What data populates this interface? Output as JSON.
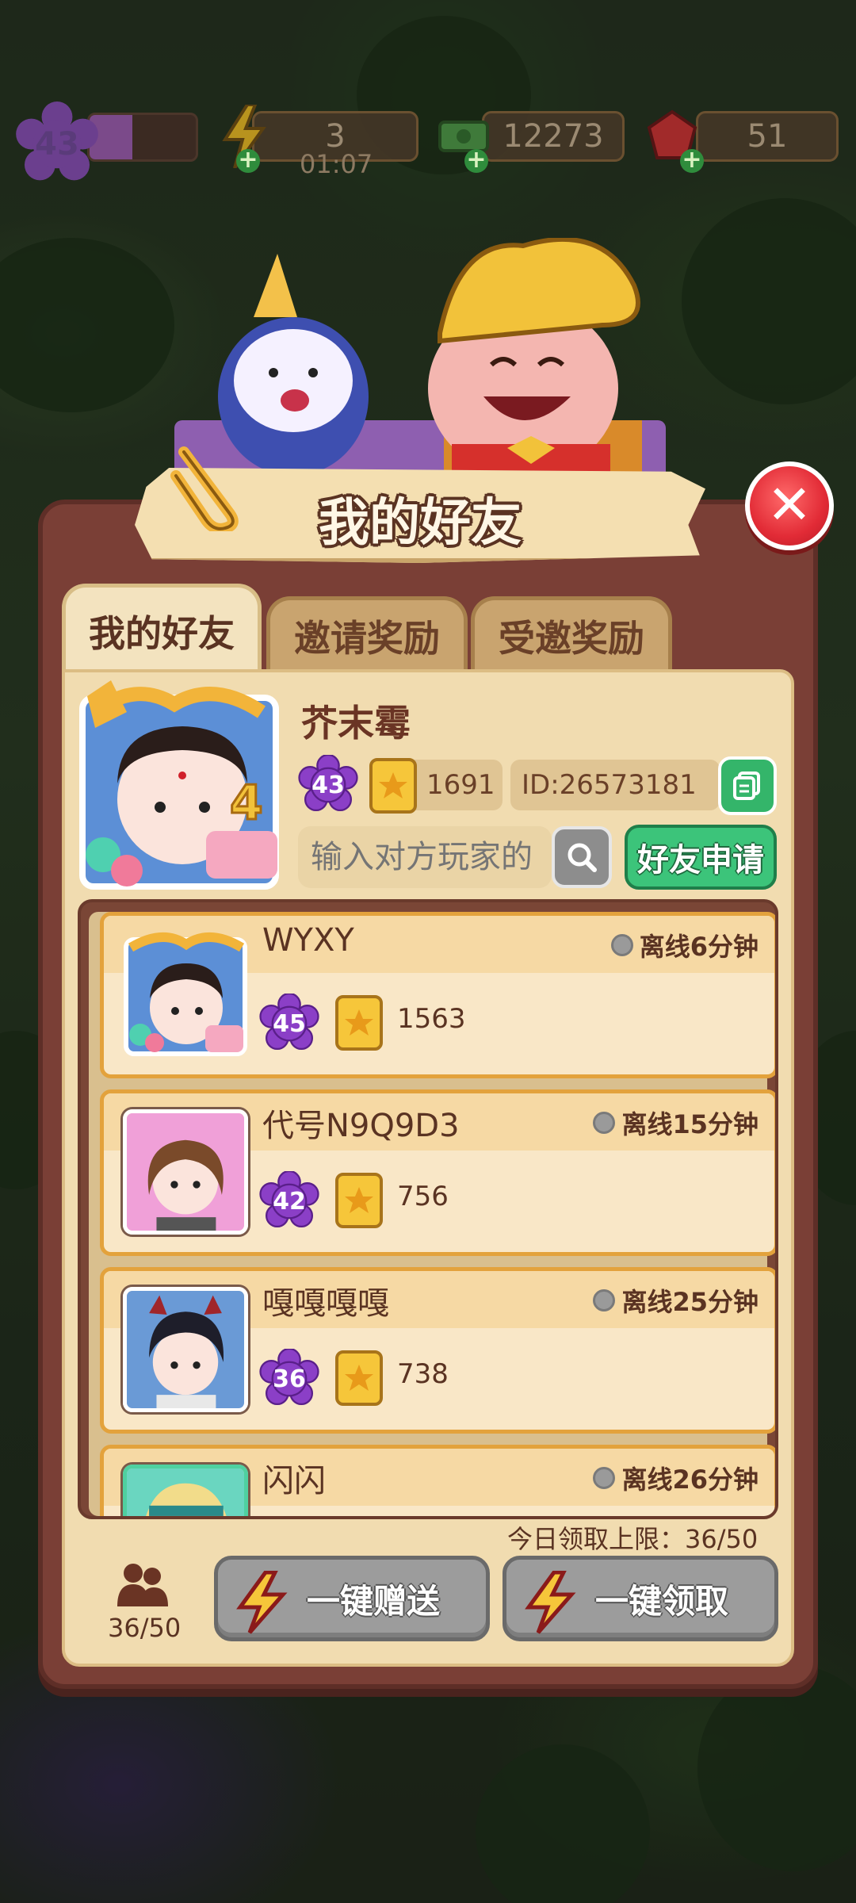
{
  "resources": {
    "level": "43",
    "xp_fraction": 0.4,
    "energy": "3",
    "energy_timer": "01:07",
    "cash": "12273",
    "gems": "51"
  },
  "panel": {
    "title": "我的好友",
    "tabs": [
      {
        "label": "我的好友",
        "active": true
      },
      {
        "label": "邀请奖励",
        "active": false
      },
      {
        "label": "受邀奖励",
        "active": false
      }
    ]
  },
  "profile": {
    "name": "芥末霉",
    "level": "43",
    "score": "1691",
    "id": "ID:26573181"
  },
  "search": {
    "placeholder": "输入对方玩家的",
    "add_label": "好友申请"
  },
  "friends": [
    {
      "name": "WYXY",
      "status": "离线6分钟",
      "level": "45",
      "score": "1563"
    },
    {
      "name": "代号N9Q9D3",
      "status": "离线15分钟",
      "level": "42",
      "score": "756"
    },
    {
      "name": "嘎嘎嘎嘎",
      "status": "离线25分钟",
      "level": "36",
      "score": "738"
    },
    {
      "name": "闪闪",
      "status": "离线26分钟",
      "level": "",
      "score": ""
    }
  ],
  "footer": {
    "limit_text": "今日领取上限：36/50",
    "friend_count": "36/50",
    "send_all_label": "一键赠送",
    "claim_all_label": "一键领取"
  },
  "colors": {
    "panel": "#7a3f36",
    "content": "#f1dcb0",
    "accent_green": "#3cc47a",
    "close_red": "#e22b36",
    "row_border": "#e3a23c"
  }
}
